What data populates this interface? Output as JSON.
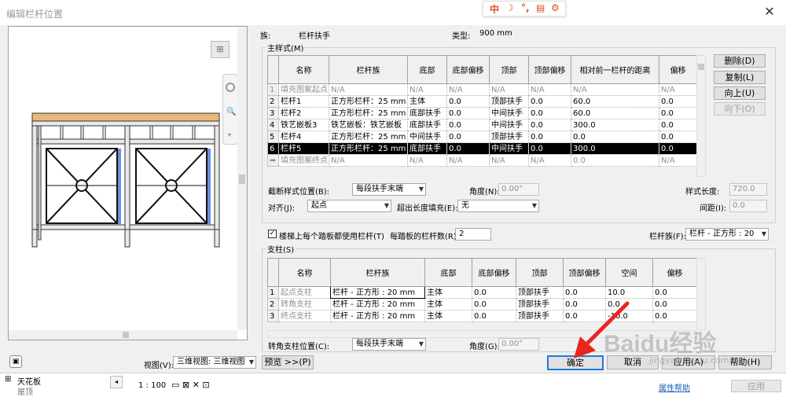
{
  "window": {
    "title": "编辑栏杆位置",
    "close_icon": "close-icon"
  },
  "ime": {
    "items": [
      "中",
      "☽",
      "°,",
      "▤",
      "⚙"
    ]
  },
  "header": {
    "family_label": "族:",
    "family_value": "栏杆扶手",
    "type_label": "类型:",
    "type_value": "900 mm"
  },
  "main_pattern": {
    "title": "主样式(M)",
    "columns": [
      "",
      "名称",
      "栏杆族",
      "底部",
      "底部偏移",
      "顶部",
      "顶部偏移",
      "相对前一栏杆的距离",
      "偏移"
    ],
    "rows": [
      [
        "1",
        "填充图案起点",
        "N/A",
        "N/A",
        "N/A",
        "N/A",
        "N/A",
        "N/A",
        "N/A"
      ],
      [
        "2",
        "栏杆1",
        "正方形栏杆：25 mm",
        "主体",
        "0.0",
        "顶部扶手",
        "0.0",
        "60.0",
        "0.0"
      ],
      [
        "3",
        "栏杆2",
        "正方形栏杆：25 mm",
        "底部扶手",
        "0.0",
        "中间扶手",
        "0.0",
        "60.0",
        "0.0"
      ],
      [
        "4",
        "铁艺嵌板3",
        "铁艺嵌板：铁艺嵌板",
        "底部扶手",
        "0.0",
        "中间扶手",
        "0.0",
        "300.0",
        "0.0"
      ],
      [
        "5",
        "栏杆4",
        "正方形栏杆：25 mm",
        "中间扶手",
        "0.0",
        "顶部扶手",
        "0.0",
        "0.0",
        "0.0"
      ],
      [
        "6",
        "栏杆5",
        "正方形栏杆：25 mm",
        "底部扶手",
        "0.0",
        "中间扶手",
        "0.0",
        "300.0",
        "0.0"
      ],
      [
        "➦",
        "填充图案终点",
        "N/A",
        "N/A",
        "N/A",
        "N/A",
        "N/A",
        "0.0",
        "N/A"
      ]
    ],
    "buttons": {
      "delete": "删除(D)",
      "copy": "复制(L)",
      "up": "向上(U)",
      "down": "向下(O)"
    }
  },
  "pattern_options": {
    "break_label": "截断样式位置(B):",
    "break_value": "每段扶手末端",
    "angle_label": "角度(N):",
    "angle_value": "0.00°",
    "length_label": "样式长度:",
    "length_value": "720.0",
    "align_label": "对齐(J):",
    "align_value": "起点",
    "fill_label": "超出长度填充(E):",
    "fill_value": "无",
    "spacing_label": "间距(I):",
    "spacing_value": "0.0"
  },
  "treads": {
    "checkbox_label": "楼梯上每个踏板都使用栏杆(T)",
    "checked": true,
    "per_tread_label": "每踏板的栏杆数(R):",
    "per_tread_value": "2",
    "family_label": "栏杆族(F):",
    "family_value": "栏杆 - 正方形 : 20"
  },
  "posts": {
    "title": "支柱(S)",
    "columns": [
      "",
      "名称",
      "栏杆族",
      "底部",
      "底部偏移",
      "顶部",
      "顶部偏移",
      "空间",
      "偏移"
    ],
    "rows": [
      [
        "1",
        "起点支柱",
        "栏杆 - 正方形 : 20 mm",
        "主体",
        "0.0",
        "顶部扶手",
        "0.0",
        "10.0",
        "0.0"
      ],
      [
        "2",
        "转角支柱",
        "栏杆 - 正方形 : 20 mm",
        "主体",
        "0.0",
        "顶部扶手",
        "0.0",
        "0.0",
        "0.0"
      ],
      [
        "3",
        "终点支柱",
        "栏杆 - 正方形 : 20 mm",
        "主体",
        "0.0",
        "顶部扶手",
        "0.0",
        "-10.0",
        "0.0"
      ]
    ],
    "corner_label": "转角支柱位置(C):",
    "corner_value": "每段扶手末端",
    "corner_angle_label": "角度(G):",
    "corner_angle_value": "0.00°"
  },
  "bottom": {
    "view_label": "视图(V):",
    "view_value": "三维视图: 三维视图",
    "preview_button": "预览 >>(P)",
    "ok": "确定",
    "cancel": "取消",
    "apply": "应用(A)",
    "help": "帮助(H)"
  },
  "statusbar": {
    "tree_item": "天花板",
    "tree_item2": "屋顶",
    "scale": "1 : 100",
    "properties_help": "属性帮助",
    "apply": "应用"
  },
  "watermark": {
    "text": "Baidu经验",
    "sub": "jingyan.baidu.com"
  }
}
